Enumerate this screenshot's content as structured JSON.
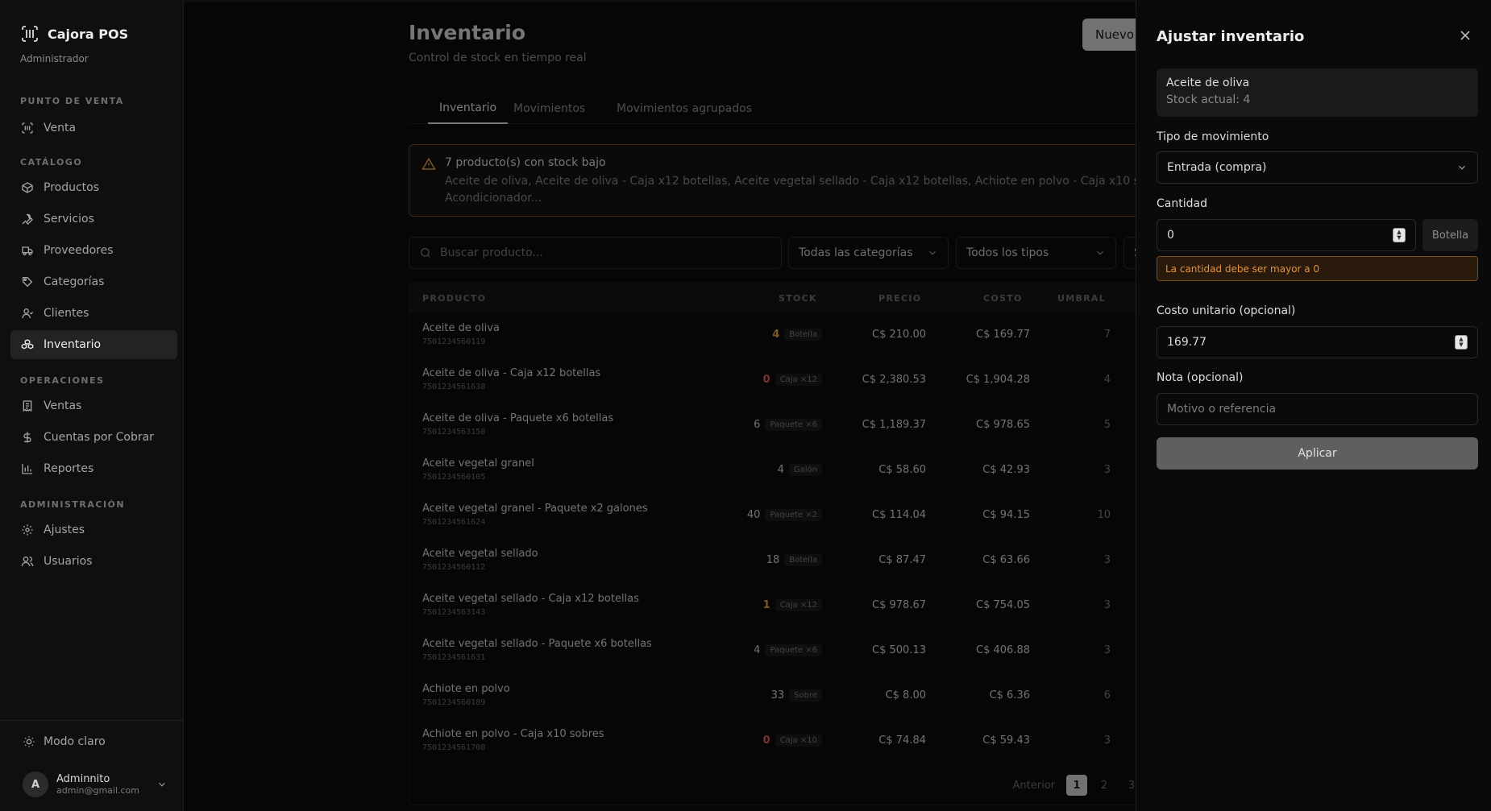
{
  "app": {
    "name": "Cajora POS",
    "role": "Administrador"
  },
  "sidebar": {
    "sections": [
      {
        "label": "PUNTO DE VENTA"
      },
      {
        "label": "CATÁLOGO"
      },
      {
        "label": "OPERACIONES"
      },
      {
        "label": "ADMINISTRACIÓN"
      }
    ],
    "items": [
      {
        "label": "Venta",
        "icon": "scan-icon"
      },
      {
        "label": "Productos",
        "icon": "box-icon"
      },
      {
        "label": "Servicios",
        "icon": "wrench-icon"
      },
      {
        "label": "Proveedores",
        "icon": "truck-icon"
      },
      {
        "label": "Categorías",
        "icon": "tag-icon"
      },
      {
        "label": "Clientes",
        "icon": "user-icon"
      },
      {
        "label": "Inventario",
        "icon": "boxes-icon",
        "active": true
      },
      {
        "label": "Ventas",
        "icon": "receipt-icon"
      },
      {
        "label": "Cuentas por Cobrar",
        "icon": "dollar-icon"
      },
      {
        "label": "Reportes",
        "icon": "bar-chart-icon"
      },
      {
        "label": "Ajustes",
        "icon": "gear-icon"
      },
      {
        "label": "Usuarios",
        "icon": "users-icon"
      }
    ],
    "mode_toggle": "Modo claro",
    "user": {
      "initial": "A",
      "name": "Adminnito",
      "email": "admin@gmail.com"
    }
  },
  "main": {
    "title": "Inventario",
    "subtitle": "Control de stock en tiempo real",
    "new_button": "Nuevo",
    "tabs": [
      "Inventario",
      "Movimientos",
      "Movimientos agrupados"
    ],
    "alert": {
      "title": "7 producto(s) con stock bajo",
      "body": "Aceite de oliva, Aceite de oliva - Caja x12 botellas, Aceite vegetal sellado - Caja x12 botellas, Achiote en polvo - Caja x10 s Acondicionador..."
    },
    "search_placeholder": "Buscar producto...",
    "filters": {
      "category": "Todas las categorías",
      "type": "Todos los tipos",
      "extra": "S"
    },
    "columns": [
      "PRODUCTO",
      "STOCK",
      "PRECIO",
      "COSTO",
      "UMBRAL"
    ],
    "rows": [
      {
        "name": "Aceite de oliva",
        "code": "7501234560119",
        "stock": "4",
        "stock_level": "low",
        "unit": "Botella",
        "price": "C$ 210.00",
        "cost": "C$ 169.77",
        "threshold": "7"
      },
      {
        "name": "Aceite de oliva - Caja x12 botellas",
        "code": "7501234561638",
        "stock": "0",
        "stock_level": "zero",
        "unit": "Caja ×12",
        "price": "C$ 2,380.53",
        "cost": "C$ 1,904.28",
        "threshold": "4"
      },
      {
        "name": "Aceite de oliva - Paquete x6 botellas",
        "code": "7501234563150",
        "stock": "6",
        "stock_level": "ok",
        "unit": "Paquete ×6",
        "price": "C$ 1,189.37",
        "cost": "C$ 978.65",
        "threshold": "5"
      },
      {
        "name": "Aceite vegetal granel",
        "code": "7501234560105",
        "stock": "4",
        "stock_level": "ok",
        "unit": "Galón",
        "price": "C$ 58.60",
        "cost": "C$ 42.93",
        "threshold": "3"
      },
      {
        "name": "Aceite vegetal granel - Paquete x2 galones",
        "code": "7501234561624",
        "stock": "40",
        "stock_level": "ok",
        "unit": "Paquete ×2",
        "price": "C$ 114.04",
        "cost": "C$ 94.15",
        "threshold": "10"
      },
      {
        "name": "Aceite vegetal sellado",
        "code": "7501234560112",
        "stock": "18",
        "stock_level": "ok",
        "unit": "Botella",
        "price": "C$ 87.47",
        "cost": "C$ 63.66",
        "threshold": "3"
      },
      {
        "name": "Aceite vegetal sellado - Caja x12 botellas",
        "code": "7501234563143",
        "stock": "1",
        "stock_level": "low",
        "unit": "Caja ×12",
        "price": "C$ 978.67",
        "cost": "C$ 754.05",
        "threshold": "3"
      },
      {
        "name": "Aceite vegetal sellado - Paquete x6 botellas",
        "code": "7501234561631",
        "stock": "4",
        "stock_level": "ok",
        "unit": "Paquete ×6",
        "price": "C$ 500.13",
        "cost": "C$ 406.88",
        "threshold": "3"
      },
      {
        "name": "Achiote en polvo",
        "code": "7501234560189",
        "stock": "33",
        "stock_level": "ok",
        "unit": "Sobre",
        "price": "C$ 8.00",
        "cost": "C$ 6.36",
        "threshold": "6"
      },
      {
        "name": "Achiote en polvo - Caja x10 sobres",
        "code": "7501234561708",
        "stock": "0",
        "stock_level": "zero",
        "unit": "Caja ×10",
        "price": "C$ 74.84",
        "cost": "C$ 59.43",
        "threshold": "3"
      }
    ],
    "pagination": {
      "prev": "Anterior",
      "pages": [
        "1",
        "2",
        "3"
      ],
      "current": "1"
    }
  },
  "drawer": {
    "title": "Ajustar inventario",
    "product": {
      "name": "Aceite de oliva",
      "stock_text": "Stock actual: 4"
    },
    "movement_label": "Tipo de movimiento",
    "movement_value": "Entrada (compra)",
    "quantity_label": "Cantidad",
    "quantity_value": "0",
    "quantity_unit": "Botella",
    "error": "La cantidad debe ser mayor a 0",
    "unit_cost_label": "Costo unitario (opcional)",
    "unit_cost_value": "169.77",
    "note_label": "Nota (opcional)",
    "note_placeholder": "Motivo o referencia",
    "apply_button": "Aplicar"
  },
  "colors": {
    "accent": "#d0d0d0",
    "warning": "#e3a04a",
    "danger": "#e25858",
    "background": "#0b0b0c"
  }
}
